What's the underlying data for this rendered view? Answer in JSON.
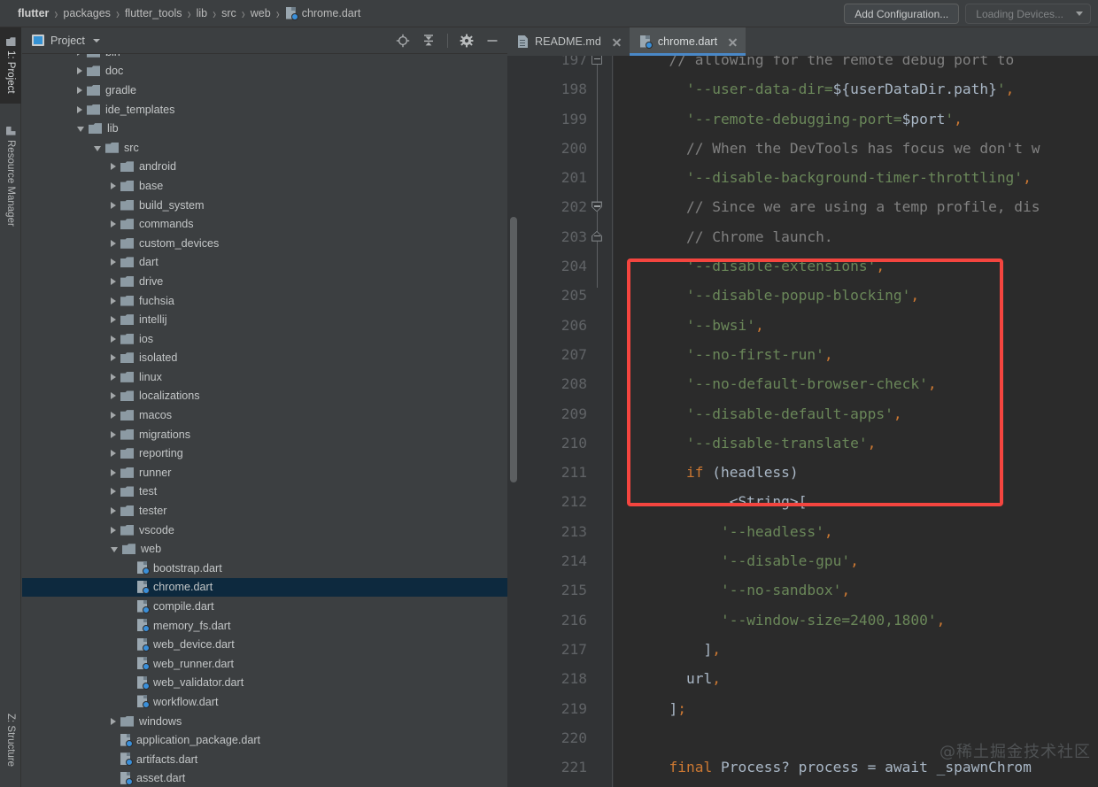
{
  "breadcrumb": {
    "items": [
      "flutter",
      "packages",
      "flutter_tools",
      "lib",
      "src",
      "web"
    ],
    "file": "chrome.dart",
    "separator": "›"
  },
  "run_toolbar": {
    "add_configuration_label": "Add Configuration...",
    "devices_label": "Loading Devices..."
  },
  "left_tool_strip": {
    "top_tabs": [
      {
        "label": "1: Project",
        "icon": "folder-icon",
        "active": true
      },
      {
        "label": "Resource Manager",
        "icon": "resource-icon",
        "active": false
      }
    ],
    "bottom_tabs": [
      {
        "label": "Z: Structure",
        "icon": "structure-icon",
        "active": false
      }
    ]
  },
  "project_panel": {
    "title": "Project",
    "toolbar_icons": [
      "locate-icon",
      "collapse-all-icon",
      "settings-gear-icon",
      "hide-icon"
    ],
    "tree": [
      {
        "label": "bin",
        "depth": 1,
        "type": "folder",
        "state": "collapsed",
        "partial": true
      },
      {
        "label": "doc",
        "depth": 1,
        "type": "folder",
        "state": "collapsed"
      },
      {
        "label": "gradle",
        "depth": 1,
        "type": "folder",
        "state": "collapsed"
      },
      {
        "label": "ide_templates",
        "depth": 1,
        "type": "folder",
        "state": "collapsed"
      },
      {
        "label": "lib",
        "depth": 1,
        "type": "folder",
        "state": "expanded"
      },
      {
        "label": "src",
        "depth": 2,
        "type": "folder",
        "state": "expanded"
      },
      {
        "label": "android",
        "depth": 3,
        "type": "folder",
        "state": "collapsed"
      },
      {
        "label": "base",
        "depth": 3,
        "type": "folder",
        "state": "collapsed"
      },
      {
        "label": "build_system",
        "depth": 3,
        "type": "folder",
        "state": "collapsed"
      },
      {
        "label": "commands",
        "depth": 3,
        "type": "folder",
        "state": "collapsed"
      },
      {
        "label": "custom_devices",
        "depth": 3,
        "type": "folder",
        "state": "collapsed"
      },
      {
        "label": "dart",
        "depth": 3,
        "type": "folder",
        "state": "collapsed"
      },
      {
        "label": "drive",
        "depth": 3,
        "type": "folder",
        "state": "collapsed"
      },
      {
        "label": "fuchsia",
        "depth": 3,
        "type": "folder",
        "state": "collapsed"
      },
      {
        "label": "intellij",
        "depth": 3,
        "type": "folder",
        "state": "collapsed"
      },
      {
        "label": "ios",
        "depth": 3,
        "type": "folder",
        "state": "collapsed"
      },
      {
        "label": "isolated",
        "depth": 3,
        "type": "folder",
        "state": "collapsed"
      },
      {
        "label": "linux",
        "depth": 3,
        "type": "folder",
        "state": "collapsed"
      },
      {
        "label": "localizations",
        "depth": 3,
        "type": "folder",
        "state": "collapsed"
      },
      {
        "label": "macos",
        "depth": 3,
        "type": "folder",
        "state": "collapsed"
      },
      {
        "label": "migrations",
        "depth": 3,
        "type": "folder",
        "state": "collapsed"
      },
      {
        "label": "reporting",
        "depth": 3,
        "type": "folder",
        "state": "collapsed"
      },
      {
        "label": "runner",
        "depth": 3,
        "type": "folder",
        "state": "collapsed"
      },
      {
        "label": "test",
        "depth": 3,
        "type": "folder",
        "state": "collapsed"
      },
      {
        "label": "tester",
        "depth": 3,
        "type": "folder",
        "state": "collapsed"
      },
      {
        "label": "vscode",
        "depth": 3,
        "type": "folder",
        "state": "collapsed"
      },
      {
        "label": "web",
        "depth": 3,
        "type": "folder",
        "state": "expanded"
      },
      {
        "label": "bootstrap.dart",
        "depth": 4,
        "type": "dart"
      },
      {
        "label": "chrome.dart",
        "depth": 4,
        "type": "dart",
        "selected": true
      },
      {
        "label": "compile.dart",
        "depth": 4,
        "type": "dart"
      },
      {
        "label": "memory_fs.dart",
        "depth": 4,
        "type": "dart"
      },
      {
        "label": "web_device.dart",
        "depth": 4,
        "type": "dart"
      },
      {
        "label": "web_runner.dart",
        "depth": 4,
        "type": "dart"
      },
      {
        "label": "web_validator.dart",
        "depth": 4,
        "type": "dart"
      },
      {
        "label": "workflow.dart",
        "depth": 4,
        "type": "dart"
      },
      {
        "label": "windows",
        "depth": 3,
        "type": "folder",
        "state": "collapsed"
      },
      {
        "label": "application_package.dart",
        "depth": 3,
        "type": "dart"
      },
      {
        "label": "artifacts.dart",
        "depth": 3,
        "type": "dart"
      },
      {
        "label": "asset.dart",
        "depth": 3,
        "type": "dart"
      }
    ]
  },
  "editor": {
    "tabs": [
      {
        "label": "README.md",
        "icon": "markdown-file-icon",
        "active": false
      },
      {
        "label": "chrome.dart",
        "icon": "dart-file-icon",
        "active": true
      }
    ],
    "first_line_number": 197,
    "lines": [
      {
        "num": "197",
        "fold": "minus",
        "partial_top": true,
        "spans": [
          {
            "t": "      // allowing for the remote debug port to",
            "c": "s-com"
          }
        ]
      },
      {
        "num": "198",
        "fold": "",
        "spans": [
          {
            "t": "        ",
            "c": "s-def"
          },
          {
            "t": "'--user-data-dir=",
            "c": "s-str"
          },
          {
            "t": "${userDataDir.path}",
            "c": "s-var"
          },
          {
            "t": "'",
            "c": "s-str"
          },
          {
            "t": ",",
            "c": "s-pun"
          }
        ]
      },
      {
        "num": "199",
        "fold": "",
        "spans": [
          {
            "t": "        ",
            "c": "s-def"
          },
          {
            "t": "'--remote-debugging-port=",
            "c": "s-str"
          },
          {
            "t": "$port",
            "c": "s-var"
          },
          {
            "t": "'",
            "c": "s-str"
          },
          {
            "t": ",",
            "c": "s-pun"
          }
        ]
      },
      {
        "num": "200",
        "fold": "",
        "spans": [
          {
            "t": "        // When the DevTools has focus we don't w",
            "c": "s-com"
          }
        ]
      },
      {
        "num": "201",
        "fold": "",
        "spans": [
          {
            "t": "        ",
            "c": "s-def"
          },
          {
            "t": "'--disable-background-timer-throttling'",
            "c": "s-str"
          },
          {
            "t": ",",
            "c": "s-pun"
          }
        ]
      },
      {
        "num": "202",
        "fold": "tri-dn",
        "spans": [
          {
            "t": "        // Since we are using a temp profile, dis",
            "c": "s-com"
          }
        ]
      },
      {
        "num": "203",
        "fold": "tri-up",
        "spans": [
          {
            "t": "        // Chrome launch.",
            "c": "s-com"
          }
        ]
      },
      {
        "num": "204",
        "fold": "",
        "spans": [
          {
            "t": "        ",
            "c": "s-def"
          },
          {
            "t": "'--disable-extensions'",
            "c": "s-str"
          },
          {
            "t": ",",
            "c": "s-pun"
          }
        ]
      },
      {
        "num": "205",
        "fold": "",
        "spans": [
          {
            "t": "        ",
            "c": "s-def"
          },
          {
            "t": "'--disable-popup-blocking'",
            "c": "s-str"
          },
          {
            "t": ",",
            "c": "s-pun"
          }
        ]
      },
      {
        "num": "206",
        "fold": "",
        "spans": [
          {
            "t": "        ",
            "c": "s-def"
          },
          {
            "t": "'--bwsi'",
            "c": "s-str"
          },
          {
            "t": ",",
            "c": "s-pun"
          }
        ]
      },
      {
        "num": "207",
        "fold": "",
        "spans": [
          {
            "t": "        ",
            "c": "s-def"
          },
          {
            "t": "'--no-first-run'",
            "c": "s-str"
          },
          {
            "t": ",",
            "c": "s-pun"
          }
        ]
      },
      {
        "num": "208",
        "fold": "",
        "spans": [
          {
            "t": "        ",
            "c": "s-def"
          },
          {
            "t": "'--no-default-browser-check'",
            "c": "s-str"
          },
          {
            "t": ",",
            "c": "s-pun"
          }
        ]
      },
      {
        "num": "209",
        "fold": "",
        "spans": [
          {
            "t": "        ",
            "c": "s-def"
          },
          {
            "t": "'--disable-default-apps'",
            "c": "s-str"
          },
          {
            "t": ",",
            "c": "s-pun"
          }
        ]
      },
      {
        "num": "210",
        "fold": "",
        "spans": [
          {
            "t": "        ",
            "c": "s-def"
          },
          {
            "t": "'--disable-translate'",
            "c": "s-str"
          },
          {
            "t": ",",
            "c": "s-pun"
          }
        ]
      },
      {
        "num": "211",
        "fold": "",
        "spans": [
          {
            "t": "        ",
            "c": "s-def"
          },
          {
            "t": "if",
            "c": "s-kw"
          },
          {
            "t": " (headless)",
            "c": "s-def"
          }
        ]
      },
      {
        "num": "212",
        "fold": "",
        "spans": [
          {
            "t": "          ...<String>[",
            "c": "s-def"
          }
        ]
      },
      {
        "num": "213",
        "fold": "",
        "spans": [
          {
            "t": "            ",
            "c": "s-def"
          },
          {
            "t": "'--headless'",
            "c": "s-str"
          },
          {
            "t": ",",
            "c": "s-pun"
          }
        ]
      },
      {
        "num": "214",
        "fold": "",
        "spans": [
          {
            "t": "            ",
            "c": "s-def"
          },
          {
            "t": "'--disable-gpu'",
            "c": "s-str"
          },
          {
            "t": ",",
            "c": "s-pun"
          }
        ]
      },
      {
        "num": "215",
        "fold": "",
        "spans": [
          {
            "t": "            ",
            "c": "s-def"
          },
          {
            "t": "'--no-sandbox'",
            "c": "s-str"
          },
          {
            "t": ",",
            "c": "s-pun"
          }
        ]
      },
      {
        "num": "216",
        "fold": "",
        "spans": [
          {
            "t": "            ",
            "c": "s-def"
          },
          {
            "t": "'--window-size=2400,1800'",
            "c": "s-str"
          },
          {
            "t": ",",
            "c": "s-pun"
          }
        ]
      },
      {
        "num": "217",
        "fold": "",
        "spans": [
          {
            "t": "          ]",
            "c": "s-def"
          },
          {
            "t": ",",
            "c": "s-pun"
          }
        ]
      },
      {
        "num": "218",
        "fold": "",
        "spans": [
          {
            "t": "        url",
            "c": "s-def"
          },
          {
            "t": ",",
            "c": "s-pun"
          }
        ]
      },
      {
        "num": "219",
        "fold": "",
        "spans": [
          {
            "t": "      ]",
            "c": "s-def"
          },
          {
            "t": ";",
            "c": "s-pun"
          }
        ]
      },
      {
        "num": "220",
        "fold": "",
        "spans": [
          {
            "t": "",
            "c": "s-def"
          }
        ]
      },
      {
        "num": "221",
        "fold": "",
        "spans": [
          {
            "t": "      ",
            "c": "s-def"
          },
          {
            "t": "final",
            "c": "s-kw"
          },
          {
            "t": " Process? process = await _spawnChrom",
            "c": "s-def"
          }
        ]
      }
    ],
    "highlight_box_color": "#f4453f",
    "watermark": "@稀土掘金技术社区"
  }
}
